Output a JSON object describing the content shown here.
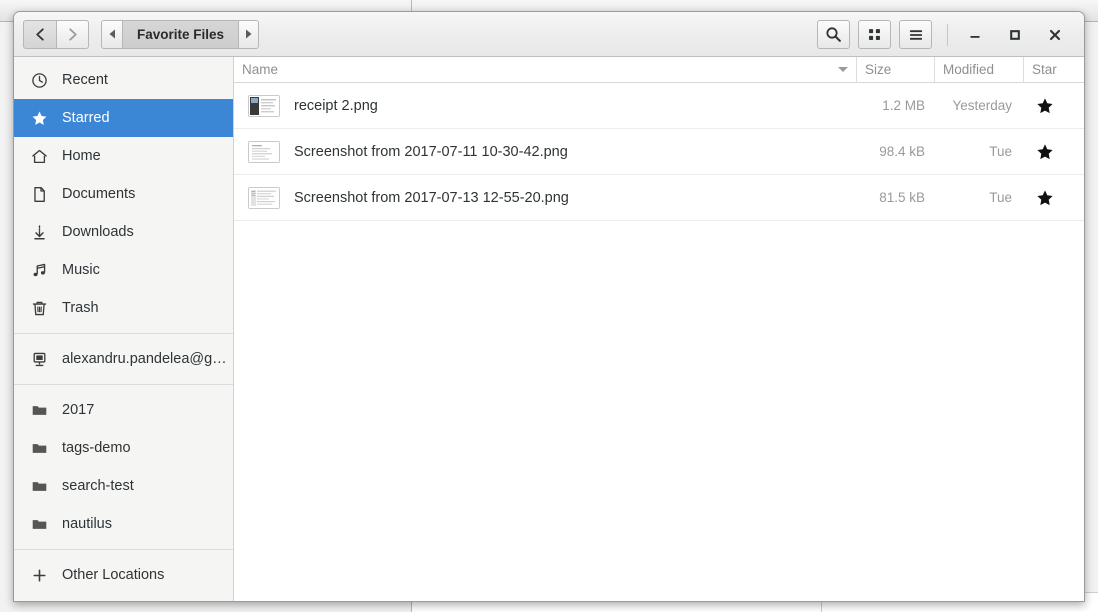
{
  "window": {
    "title": "Favorite Files",
    "nav": {
      "back_icon": "chevron-left-icon",
      "forward_icon": "chevron-right-icon"
    },
    "breadcrumb": {
      "prev_icon": "triangle-left-icon",
      "current_label": "Favorite Files",
      "next_icon": "triangle-right-icon"
    },
    "toolbar": {
      "search_icon": "search-icon",
      "grid_view_icon": "grid-view-icon",
      "menu_icon": "hamburger-menu-icon"
    },
    "controls": {
      "minimize_icon": "minimize-icon",
      "maximize_icon": "maximize-icon",
      "close_icon": "close-icon"
    }
  },
  "sidebar": {
    "places": [
      {
        "label": "Recent",
        "icon": "clock-icon",
        "selected": false
      },
      {
        "label": "Starred",
        "icon": "star-icon",
        "selected": true
      },
      {
        "label": "Home",
        "icon": "home-icon",
        "selected": false
      },
      {
        "label": "Documents",
        "icon": "document-icon",
        "selected": false
      },
      {
        "label": "Downloads",
        "icon": "download-icon",
        "selected": false
      },
      {
        "label": "Music",
        "icon": "music-note-icon",
        "selected": false
      },
      {
        "label": "Trash",
        "icon": "trash-icon",
        "selected": false
      }
    ],
    "account": {
      "label": "alexandru.pandelea@g…",
      "icon": "remote-computer-icon"
    },
    "bookmarks": [
      {
        "label": "2017",
        "icon": "folder-icon"
      },
      {
        "label": "tags-demo",
        "icon": "folder-icon"
      },
      {
        "label": "search-test",
        "icon": "folder-icon"
      },
      {
        "label": "nautilus",
        "icon": "folder-icon"
      }
    ],
    "other_locations": {
      "label": "Other Locations",
      "icon": "plus-icon"
    }
  },
  "file_list": {
    "columns": {
      "name": "Name",
      "size": "Size",
      "modified": "Modified",
      "star": "Star"
    },
    "sort": {
      "column": "name",
      "direction": "descending",
      "icon": "sort-descending-icon"
    },
    "rows": [
      {
        "name": "receipt 2.png",
        "size": "1.2 MB",
        "modified": "Yesterday",
        "starred": true,
        "thumbnail": "photo-thumbnail"
      },
      {
        "name": "Screenshot from 2017-07-11 10-30-42.png",
        "size": "98.4 kB",
        "modified": "Tue",
        "starred": true,
        "thumbnail": "screenshot-thumbnail"
      },
      {
        "name": "Screenshot from 2017-07-13 12-55-20.png",
        "size": "81.5 kB",
        "modified": "Tue",
        "starred": true,
        "thumbnail": "screenshot-thumbnail"
      }
    ]
  },
  "colors": {
    "selection_blue": "#3b87d6",
    "sidebar_bg": "#f5f5f4",
    "headerbar_bg": "#ededed",
    "star_fill": "#111111",
    "muted_text": "#9a9a9a"
  }
}
